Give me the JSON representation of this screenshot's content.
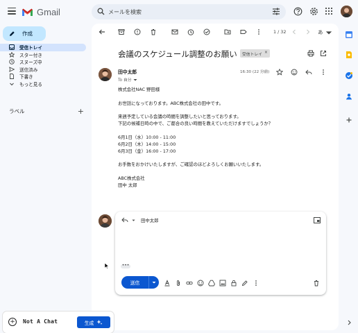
{
  "header": {
    "app_name": "Gmail",
    "search_placeholder": "メールを検索"
  },
  "nav": {
    "compose_label": "作成",
    "items": [
      {
        "label": "受信トレイ",
        "icon": "inbox-icon",
        "active": true
      },
      {
        "label": "スター付き",
        "icon": "star-icon"
      },
      {
        "label": "スヌーズ中",
        "icon": "clock-icon"
      },
      {
        "label": "送信済み",
        "icon": "send-icon"
      },
      {
        "label": "下書き",
        "icon": "draft-icon"
      },
      {
        "label": "もっと見る",
        "icon": "chevron-down-icon"
      }
    ],
    "labels_header": "ラベル"
  },
  "toolbar": {
    "page_count": "1 / 32",
    "lang_label": "あ"
  },
  "message": {
    "subject": "会議のスケジュール調整のお願い",
    "tag": "受信トレイ",
    "tag_close": "×",
    "sender": "田中太郎",
    "to_label": "To 自分",
    "time": "16:30 (22 分前)",
    "body": [
      "株式会社NAC 野田様",
      "",
      "お世話になっております。ABC株式会社の田中です。",
      "",
      "来週予定している会議の時間を調整したいと思っております。",
      "下記の候補日時の中で、ご都合の良い時間を教えていただけますでしょうか？",
      "",
      "6月1日（水）10:00 - 11:00",
      "6月2日（木）14:00 - 15:00",
      "6月3日（金）16:00 - 17:00",
      "",
      "お手数をおかけいたしますが、ご確認のほどよろしくお願いいたします。",
      "",
      "ABC株式会社",
      "田中 太郎"
    ]
  },
  "reply": {
    "recipient": "田中太郎",
    "dots_label": "•••",
    "send_label": "送信"
  },
  "widget": {
    "name": "Not A Chat",
    "generate_label": "生成"
  },
  "colors": {
    "accent": "#0b57d0",
    "compose_bg": "#c2e7ff",
    "active_nav_bg": "#d3e3fd"
  }
}
